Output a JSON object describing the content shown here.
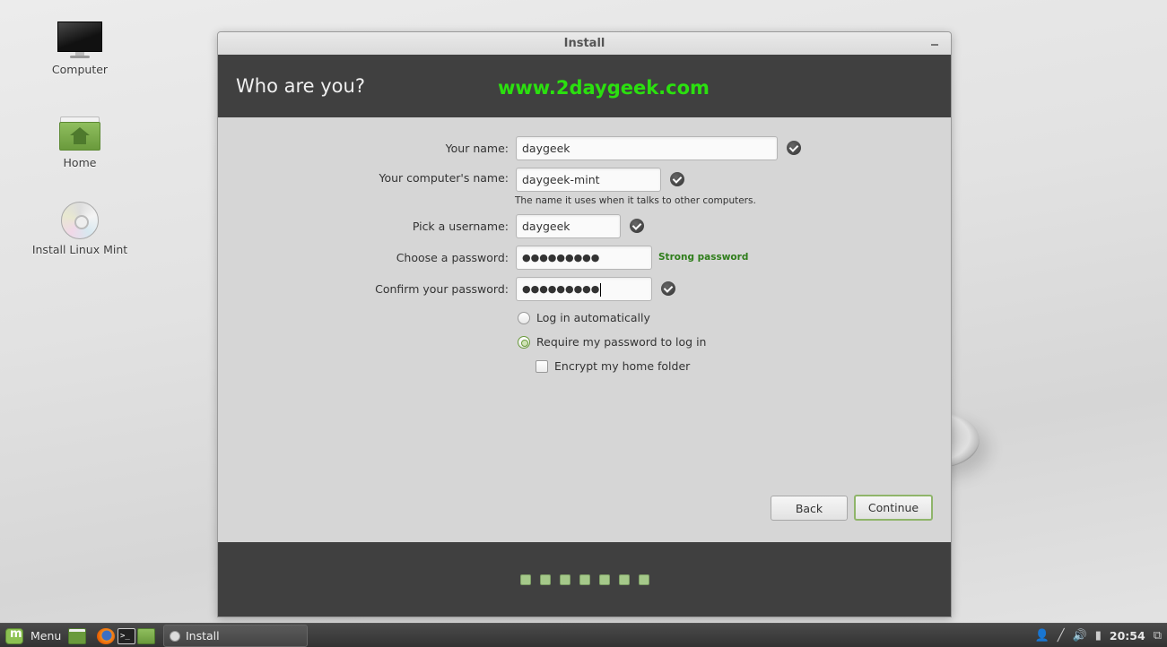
{
  "desktop": {
    "icons": [
      {
        "label": "Computer",
        "icon": "computer-icon"
      },
      {
        "label": "Home",
        "icon": "home-folder-icon"
      },
      {
        "label": "Install Linux Mint",
        "icon": "cd-icon"
      }
    ]
  },
  "window": {
    "title": "Install",
    "minimize_icon": "minimize-icon",
    "header": {
      "heading": "Who are you?",
      "watermark": "www.2daygeek.com"
    },
    "form": {
      "your_name": {
        "label": "Your name:",
        "value": "daygeek",
        "valid": true
      },
      "computer_name": {
        "label": "Your computer's name:",
        "value": "daygeek-mint",
        "valid": true,
        "hint": "The name it uses when it talks to other computers."
      },
      "username": {
        "label": "Pick a username:",
        "value": "daygeek",
        "valid": true
      },
      "password": {
        "label": "Choose a password:",
        "value": "●●●●●●●●●",
        "strength": "Strong password"
      },
      "confirm_password": {
        "label": "Confirm your password:",
        "value": "●●●●●●●●●",
        "valid": true
      },
      "login_options": [
        {
          "label": "Log in automatically",
          "selected": false
        },
        {
          "label": "Require my password to log in",
          "selected": true
        }
      ],
      "encrypt_home": {
        "label": "Encrypt my home folder",
        "checked": false
      }
    },
    "buttons": {
      "back": "Back",
      "continue": "Continue"
    },
    "progress": {
      "steps_total": 7,
      "accent": "#a5c98a"
    }
  },
  "taskbar": {
    "menu_label": "Menu",
    "quick_launch": [
      "show-desktop-icon",
      "firefox-icon",
      "terminal-icon",
      "files-icon"
    ],
    "tasks": [
      {
        "label": "Install",
        "icon": "cd-icon"
      }
    ],
    "tray": [
      "user-icon",
      "network-icon",
      "volume-icon",
      "battery-icon"
    ],
    "clock": "20:54",
    "workspace_icon": "workspace-switcher-icon"
  },
  "colors": {
    "header_bg": "#404040",
    "watermark": "#2be00f",
    "strength_text": "#2e7d1a",
    "accent_green": "#8fb56a"
  }
}
